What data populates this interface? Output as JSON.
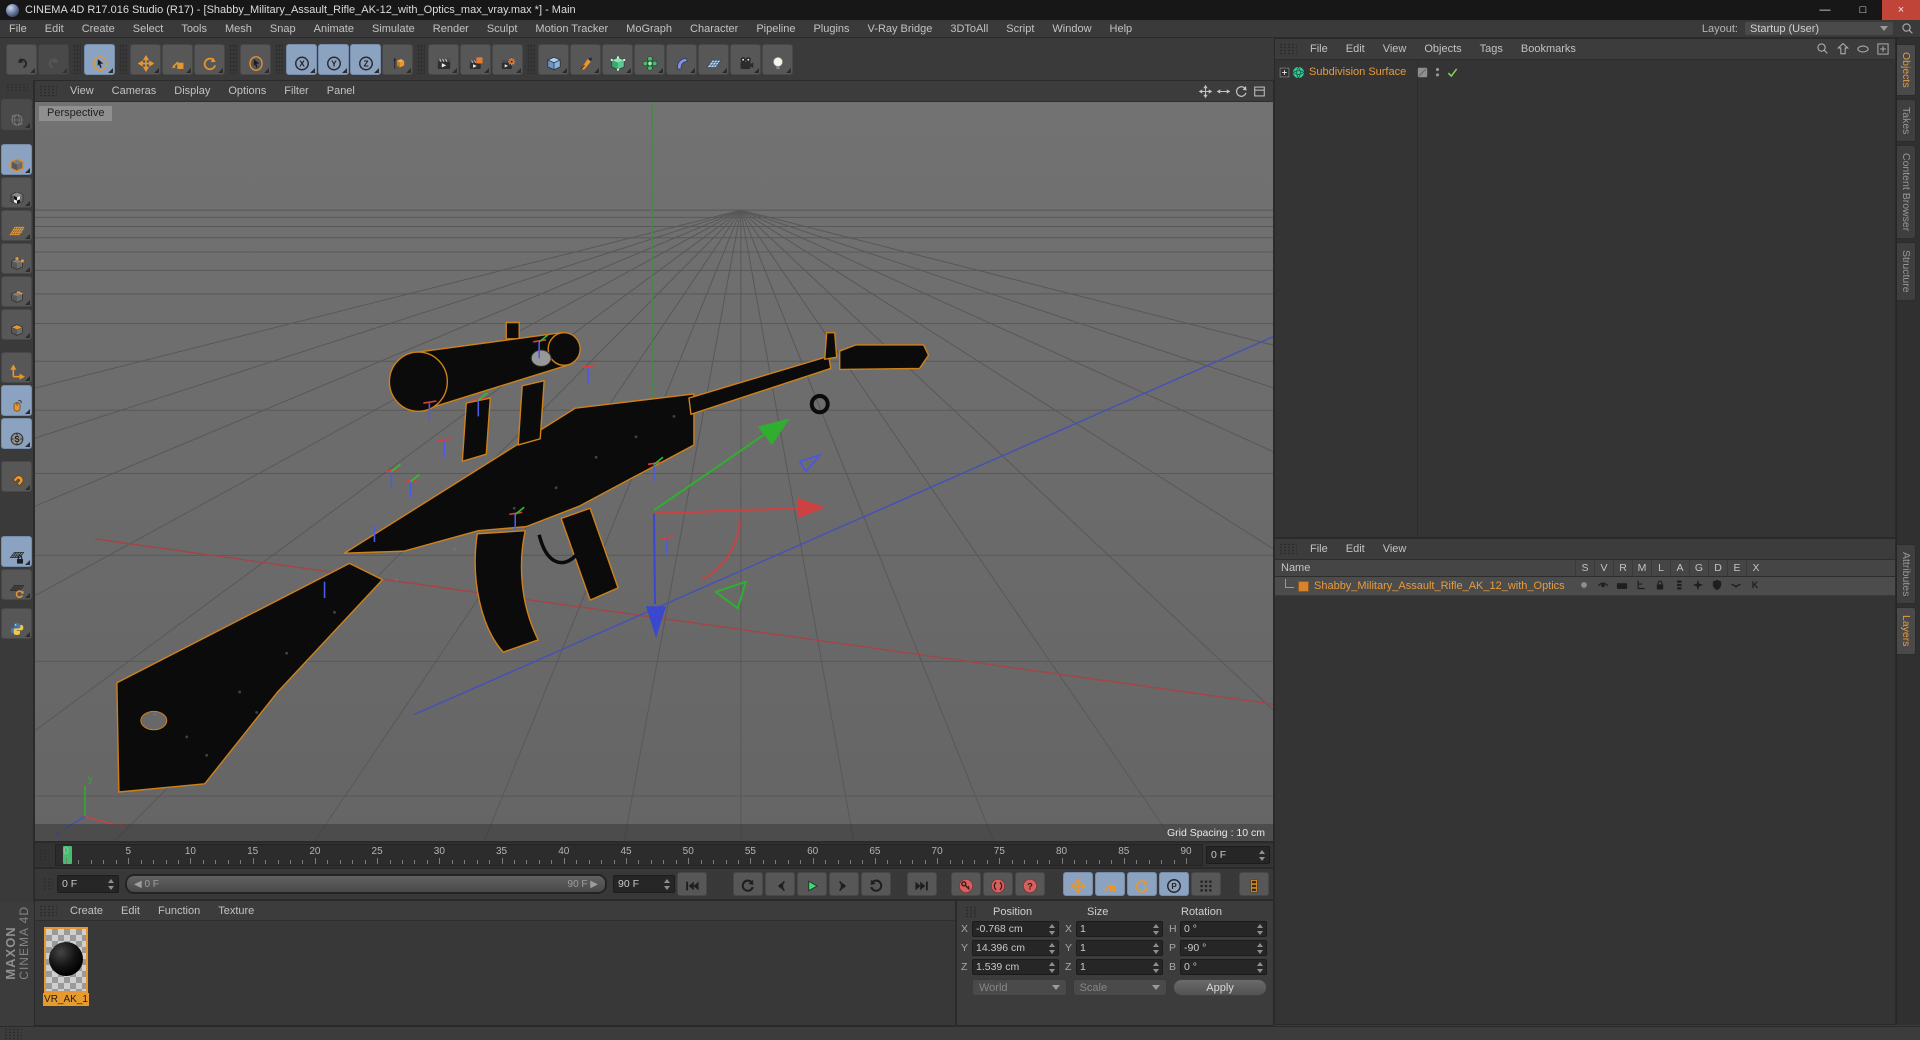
{
  "titlebar": {
    "title": "CINEMA 4D R17.016 Studio (R17) - [Shabby_Military_Assault_Rifle_AK-12_with_Optics_max_vray.max *] - Main"
  },
  "window_controls": {
    "minimize": "—",
    "maximize": "□",
    "close": "×"
  },
  "menubar": {
    "items": [
      "File",
      "Edit",
      "Create",
      "Select",
      "Tools",
      "Mesh",
      "Snap",
      "Animate",
      "Simulate",
      "Render",
      "Sculpt",
      "Motion Tracker",
      "MoGraph",
      "Character",
      "Pipeline",
      "Plugins",
      "V-Ray Bridge",
      "3DToAll",
      "Script",
      "Window",
      "Help"
    ],
    "layout_label": "Layout:",
    "layout_value": "Startup (User)"
  },
  "toolbar": {
    "groups": [
      [
        {
          "name": "undo",
          "icon": "undo"
        },
        {
          "name": "redo",
          "icon": "redo",
          "disabled": true
        }
      ],
      [
        {
          "name": "live-selection",
          "icon": "cursor-ring",
          "active": true
        }
      ],
      [
        {
          "name": "move",
          "icon": "move"
        },
        {
          "name": "scale",
          "icon": "scale"
        },
        {
          "name": "rotate",
          "icon": "rotate"
        }
      ],
      [
        {
          "name": "last-used-tool",
          "icon": "cursor-ring"
        }
      ],
      [
        {
          "name": "lock-x-axis",
          "icon": "axis-x",
          "active": true
        },
        {
          "name": "lock-y-axis",
          "icon": "axis-y",
          "active": true
        },
        {
          "name": "lock-z-axis",
          "icon": "axis-z",
          "active": true
        },
        {
          "name": "coordinate-system",
          "icon": "coordsys"
        }
      ],
      [
        {
          "name": "render-view",
          "icon": "render"
        },
        {
          "name": "render-picture-viewer",
          "icon": "render-pv"
        },
        {
          "name": "render-settings",
          "icon": "render-settings"
        }
      ],
      [
        {
          "name": "add-cube",
          "icon": "cube"
        },
        {
          "name": "add-spline",
          "icon": "pen"
        },
        {
          "name": "add-subdivision-surface",
          "icon": "subdiv"
        },
        {
          "name": "add-deformer",
          "icon": "deformer"
        },
        {
          "name": "add-modeling-object",
          "icon": "bend"
        },
        {
          "name": "add-environment",
          "icon": "floor"
        },
        {
          "name": "add-camera",
          "icon": "camera"
        },
        {
          "name": "add-light",
          "icon": "light"
        }
      ]
    ]
  },
  "left_palette": {
    "buttons": [
      {
        "name": "convert-object",
        "icon": "globe",
        "disabled": true,
        "gap": 4
      },
      {
        "name": "model-mode",
        "icon": "mode-model",
        "active": true,
        "gap": 12
      },
      {
        "name": "texture-mode",
        "icon": "mode-texture"
      },
      {
        "name": "workplane-mode",
        "icon": "mode-workplane"
      },
      {
        "name": "points-mode",
        "icon": "mode-points"
      },
      {
        "name": "edges-mode",
        "icon": "mode-edges"
      },
      {
        "name": "polygons-mode",
        "icon": "mode-polys"
      },
      {
        "name": "axis-mode",
        "icon": "mode-axis",
        "gap": 10
      },
      {
        "name": "tweak-mode",
        "icon": "mouse",
        "active": true
      },
      {
        "name": "snap-settings",
        "icon": "snap-s",
        "active": true
      },
      {
        "name": "enable-snap",
        "icon": "magnet",
        "gap": 10
      },
      {
        "name": "lock-workplane",
        "icon": "wp-lock",
        "active": true,
        "gap": 42
      },
      {
        "name": "workplane-snapping",
        "icon": "wp-rotate"
      },
      {
        "name": "python-scripting",
        "icon": "python",
        "gap": 6
      }
    ]
  },
  "viewport": {
    "menu": [
      "View",
      "Cameras",
      "Display",
      "Options",
      "Filter",
      "Panel"
    ],
    "nav_icons": [
      "pan-view",
      "zoom-view",
      "rotate-view",
      "toggle-view"
    ],
    "camera_label": "Perspective",
    "status_text": "Grid Spacing : 10 cm",
    "axis_indicator": {
      "x": "x",
      "y": "y",
      "z": "z"
    }
  },
  "timeline": {
    "start": 0,
    "end": 90,
    "label_step": 5,
    "playhead_frame": 0,
    "frame_field": "0 F"
  },
  "transport": {
    "frame_field": "0 F",
    "range_start": "0 F",
    "range_end": "90 F",
    "end_field": "90 F",
    "buttons": [
      {
        "name": "goto-start",
        "icon": "goto-start",
        "gap": 2
      },
      {
        "name": "previous-key",
        "icon": "prev-key",
        "gap": 26
      },
      {
        "name": "previous-frame",
        "icon": "prev-frame"
      },
      {
        "name": "play",
        "icon": "play"
      },
      {
        "name": "next-frame",
        "icon": "next-frame"
      },
      {
        "name": "next-key",
        "icon": "next-key"
      },
      {
        "name": "goto-end",
        "icon": "goto-end",
        "gap": 16
      },
      {
        "name": "record-keyframe",
        "icon": "key-record",
        "gap": 14
      },
      {
        "name": "autokeying",
        "icon": "key-auto"
      },
      {
        "name": "keyframe-selection",
        "icon": "key-question"
      },
      {
        "name": "record-position",
        "icon": "move",
        "active": true,
        "gap": 18
      },
      {
        "name": "record-scale",
        "icon": "scale",
        "active": true
      },
      {
        "name": "record-rotation",
        "icon": "rotate",
        "active": true
      },
      {
        "name": "record-parameter",
        "icon": "rec-param",
        "active": true
      },
      {
        "name": "point-level-animation",
        "icon": "pla-dots"
      },
      {
        "name": "make-preview",
        "icon": "film",
        "gap": 18
      }
    ]
  },
  "materials": {
    "menu": [
      "Create",
      "Edit",
      "Function",
      "Texture"
    ],
    "items": [
      {
        "label": "VR_AK_1",
        "selected": true
      }
    ]
  },
  "coordinates": {
    "position_title": "Position",
    "size_title": "Size",
    "rotation_title": "Rotation",
    "position_rows": [
      {
        "axis": "X",
        "value": "-0.768 cm"
      },
      {
        "axis": "Y",
        "value": "14.396 cm"
      },
      {
        "axis": "Z",
        "value": "1.539 cm"
      }
    ],
    "size_rows": [
      {
        "axis": "X",
        "value": "1"
      },
      {
        "axis": "Y",
        "value": "1"
      },
      {
        "axis": "Z",
        "value": "1"
      }
    ],
    "rotation_rows": [
      {
        "axis": "H",
        "value": "0 °"
      },
      {
        "axis": "P",
        "value": "-90 °"
      },
      {
        "axis": "B",
        "value": "0 °"
      }
    ],
    "world_dropdown": "World",
    "scale_dropdown": "Scale",
    "apply_button": "Apply"
  },
  "object_manager": {
    "menu": [
      "File",
      "Edit",
      "View",
      "Objects",
      "Tags",
      "Bookmarks"
    ],
    "toolbar_icons": [
      "search",
      "path-up",
      "eye-small",
      "add-box"
    ],
    "items": [
      {
        "label": "Subdivision Surface",
        "icon": "subd-ball"
      }
    ]
  },
  "layers_panel": {
    "menu": [
      "File",
      "Edit",
      "View"
    ],
    "name_header": "Name",
    "columns": [
      "S",
      "V",
      "R",
      "M",
      "L",
      "A",
      "G",
      "D",
      "E",
      "X"
    ],
    "rows": [
      {
        "label": "Shabby_Military_Assault_Rifle_AK_12_with_Optics",
        "cell_icons": [
          "dot",
          "eye",
          "filmsm",
          "hier",
          "lock",
          "list",
          "star4",
          "shield",
          "lid",
          "kglyph"
        ]
      }
    ]
  },
  "right_tabs": {
    "upper": [
      {
        "label": "Objects",
        "active": true
      },
      {
        "label": "Takes"
      },
      {
        "label": "Content Browser"
      },
      {
        "label": "Structure"
      }
    ],
    "lower": [
      {
        "label": "Attributes"
      },
      {
        "label": "Layers",
        "active": true
      }
    ]
  },
  "branding": {
    "line1": "MAXON",
    "line2": "CINEMA 4D"
  },
  "colors": {
    "accent_orange": "#e8962e",
    "selection_blue": "#8ba3c1",
    "play_green": "#47d676",
    "key_red": "#d65f5f",
    "selected_text_orange": "#e89b3c"
  }
}
